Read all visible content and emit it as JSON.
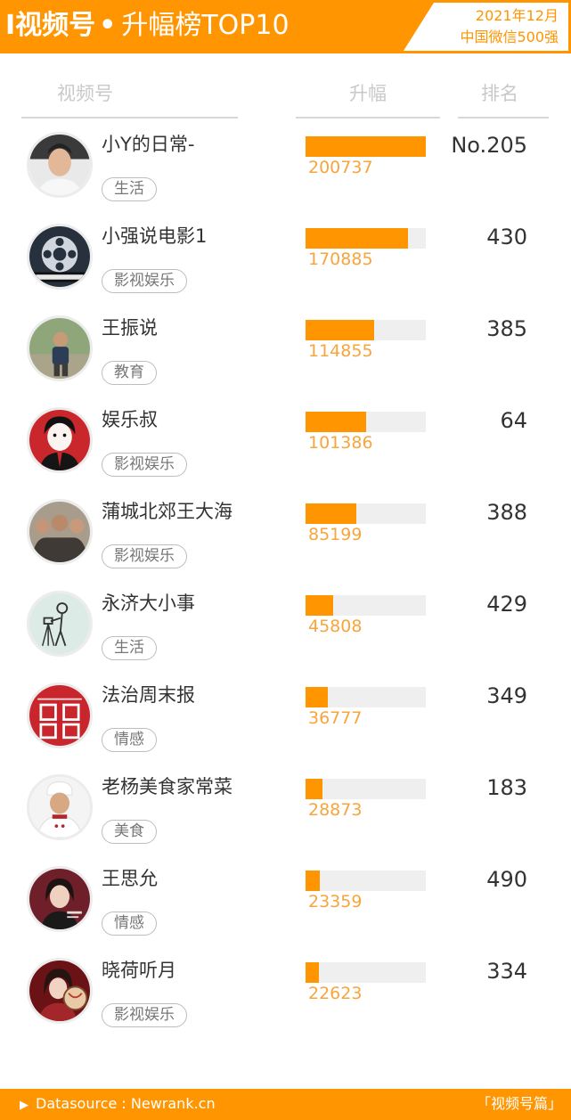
{
  "header": {
    "title_main": "I视频号",
    "title_dot": "•",
    "title_sub": "升幅榜TOP10",
    "date": "2021年12月",
    "scope": "中国微信500强"
  },
  "columns": {
    "name": "视频号",
    "rise": "升幅",
    "rank": "排名"
  },
  "footer": {
    "arrow": "▶",
    "source": "Datasource : Newrank.cn",
    "section": "「视频号篇」"
  },
  "colors": {
    "accent": "#ff9500",
    "bar_track": "#efefef",
    "value_text": "#f7a53c"
  },
  "rows": [
    {
      "name": "小Y的日常-",
      "category": "生活",
      "rise": "200737",
      "rank": "No.205",
      "avatar_icon": "young-man-avatar"
    },
    {
      "name": "小强说电影1",
      "category": "影视娱乐",
      "rise": "170885",
      "rank": "430",
      "avatar_icon": "film-reel-avatar"
    },
    {
      "name": "王振说",
      "category": "教育",
      "rise": "114855",
      "rank": "385",
      "avatar_icon": "man-outdoors-avatar"
    },
    {
      "name": "娱乐叔",
      "category": "影视娱乐",
      "rise": "101386",
      "rank": "64",
      "avatar_icon": "cartoon-man-avatar"
    },
    {
      "name": "蒲城北郊王大海",
      "category": "影视娱乐",
      "rise": "85199",
      "rank": "388",
      "avatar_icon": "group-photo-avatar"
    },
    {
      "name": "永济大小事",
      "category": "生活",
      "rise": "45808",
      "rank": "429",
      "avatar_icon": "photographer-sketch-avatar"
    },
    {
      "name": "法治周末报",
      "category": "情感",
      "rise": "36777",
      "rank": "349",
      "avatar_icon": "newspaper-seal-avatar"
    },
    {
      "name": "老杨美食家常菜",
      "category": "美食",
      "rise": "28873",
      "rank": "183",
      "avatar_icon": "chef-avatar"
    },
    {
      "name": "王思允",
      "category": "情感",
      "rise": "23359",
      "rank": "490",
      "avatar_icon": "woman-portrait-avatar"
    },
    {
      "name": "晓荷听月",
      "category": "影视娱乐",
      "rise": "22623",
      "rank": "334",
      "avatar_icon": "woman-fan-avatar"
    }
  ],
  "chart_data": {
    "type": "bar",
    "categories": [
      "小Y的日常-",
      "小强说电影1",
      "王振说",
      "娱乐叔",
      "蒲城北郊王大海",
      "永济大小事",
      "法治周末报",
      "老杨美食家常菜",
      "王思允",
      "晓荷听月"
    ],
    "values": [
      200737,
      170885,
      114855,
      101386,
      85199,
      45808,
      36777,
      28873,
      23359,
      22623
    ],
    "title": "升幅榜TOP10",
    "xlabel": "",
    "ylabel": "升幅",
    "ylim": [
      0,
      200737
    ],
    "orientation": "horizontal",
    "grid": false
  }
}
